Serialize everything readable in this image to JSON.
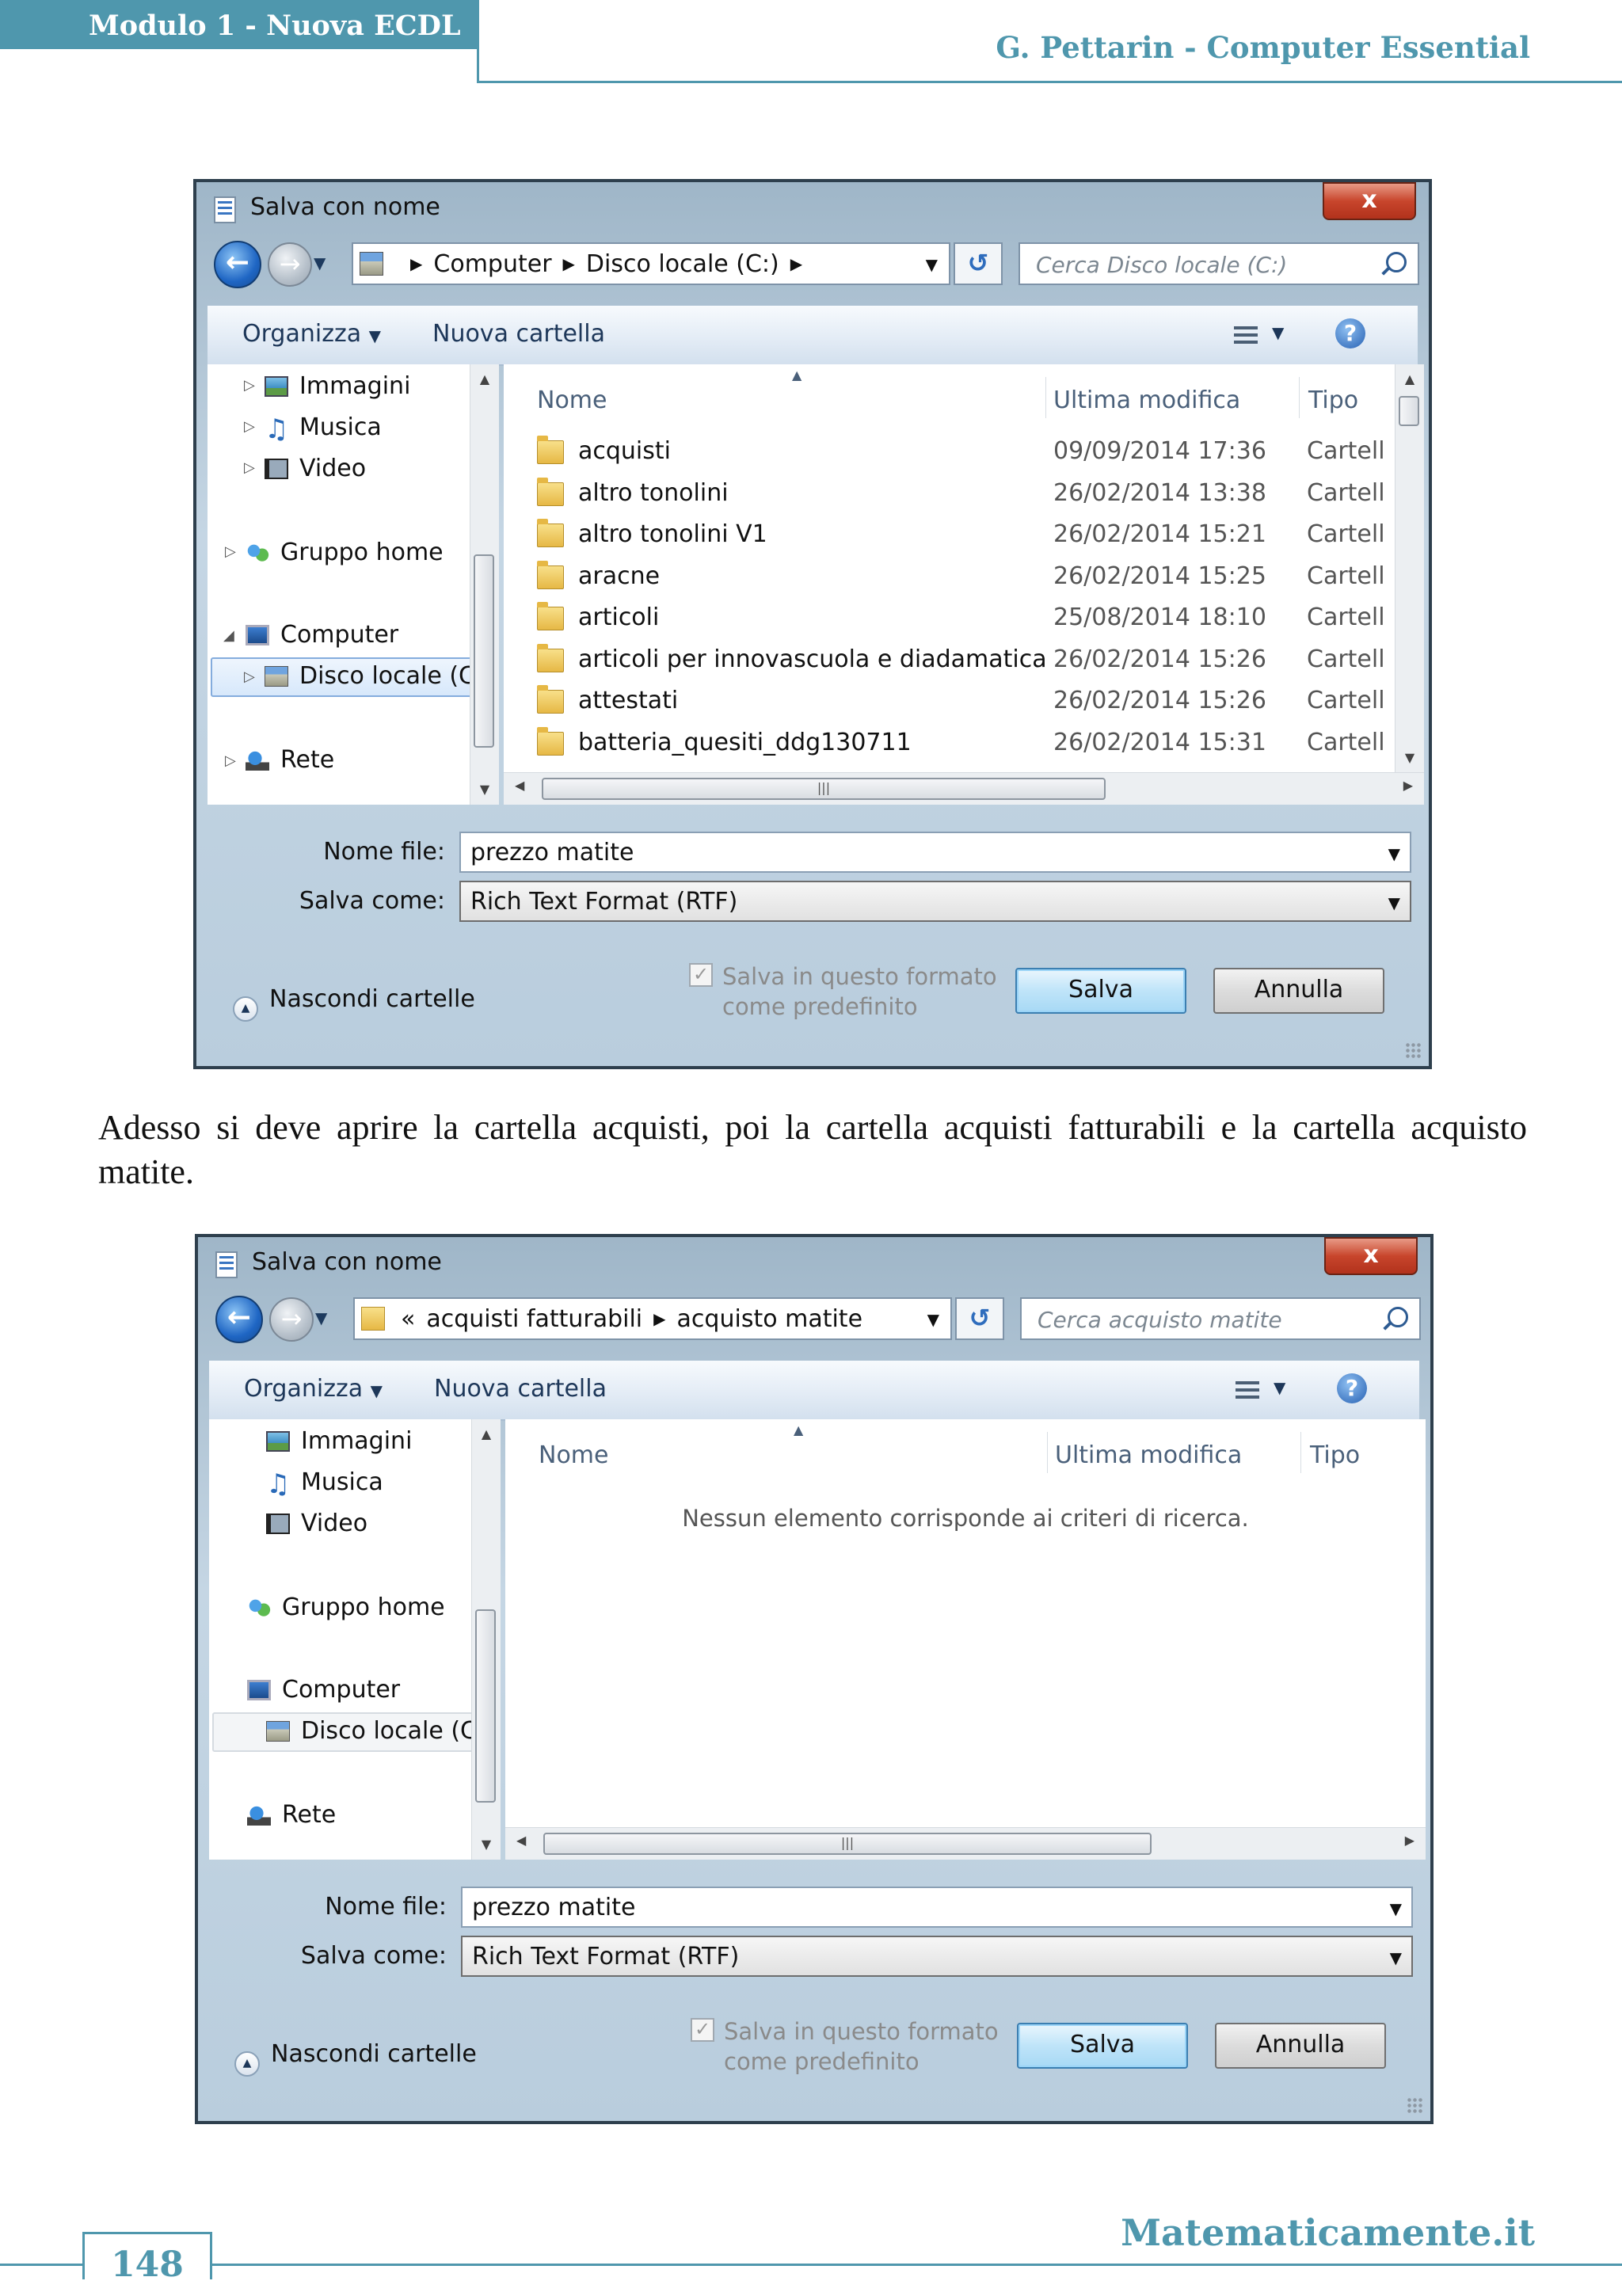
{
  "header": {
    "left": "Modulo 1 - Nuova ECDL",
    "right": "G. Pettarin - Computer Essential"
  },
  "footer": {
    "page": "148",
    "brand": "Matematicamente.it"
  },
  "paragraph": "Adesso si deve aprire la cartella acquisti, poi la cartella acquisti fatturabili e la cartella acquisto matite.",
  "dialog1": {
    "title": "Salva con nome",
    "close": "x",
    "address": [
      "Computer",
      "Disco locale (C:)",
      ""
    ],
    "search_placeholder": "Cerca Disco locale (C:)",
    "toolbar": {
      "organize": "Organizza",
      "new_folder": "Nuova cartella",
      "help": "?"
    },
    "nav": [
      "Immagini",
      "Musica",
      "Video",
      "Gruppo home",
      "Computer",
      "Disco locale (C:)",
      "Rete"
    ],
    "columns": {
      "name": "Nome",
      "modified": "Ultima modifica",
      "type": "Tipo"
    },
    "files": [
      {
        "name": "acquisti",
        "date": "09/09/2014 17:36",
        "type": "Cartell"
      },
      {
        "name": "altro tonolini",
        "date": "26/02/2014 13:38",
        "type": "Cartell"
      },
      {
        "name": "altro tonolini V1",
        "date": "26/02/2014 15:21",
        "type": "Cartell"
      },
      {
        "name": "aracne",
        "date": "26/02/2014 15:25",
        "type": "Cartell"
      },
      {
        "name": "articoli",
        "date": "25/08/2014 18:10",
        "type": "Cartell"
      },
      {
        "name": "articoli per innovascuola e diadamatica",
        "date": "26/02/2014 15:26",
        "type": "Cartell"
      },
      {
        "name": "attestati",
        "date": "26/02/2014 15:26",
        "type": "Cartell"
      },
      {
        "name": "batteria_quesiti_ddg130711",
        "date": "26/02/2014 15:31",
        "type": "Cartell"
      }
    ],
    "filename_label": "Nome file:",
    "filename_value": "prezzo matite",
    "savetype_label": "Salva come:",
    "savetype_value": "Rich Text Format (RTF)",
    "hide_folders": "Nascondi cartelle",
    "default_format_line1": "Salva in questo formato",
    "default_format_line2": "come predefinito",
    "save": "Salva",
    "cancel": "Annulla"
  },
  "dialog2": {
    "title": "Salva con nome",
    "close": "x",
    "address_prefix": "«",
    "address": [
      "acquisti fatturabili",
      "acquisto matite"
    ],
    "search_placeholder": "Cerca acquisto matite",
    "toolbar": {
      "organize": "Organizza",
      "new_folder": "Nuova cartella",
      "help": "?"
    },
    "nav": [
      "Immagini",
      "Musica",
      "Video",
      "Gruppo home",
      "Computer",
      "Disco locale (C:)",
      "Rete"
    ],
    "columns": {
      "name": "Nome",
      "modified": "Ultima modifica",
      "type": "Tipo"
    },
    "empty_message": "Nessun elemento corrisponde ai criteri di ricerca.",
    "filename_label": "Nome file:",
    "filename_value": "prezzo matite",
    "savetype_label": "Salva come:",
    "savetype_value": "Rich Text Format (RTF)",
    "hide_folders": "Nascondi cartelle",
    "default_format_line1": "Salva in questo formato",
    "default_format_line2": "come predefinito",
    "save": "Salva",
    "cancel": "Annulla"
  }
}
